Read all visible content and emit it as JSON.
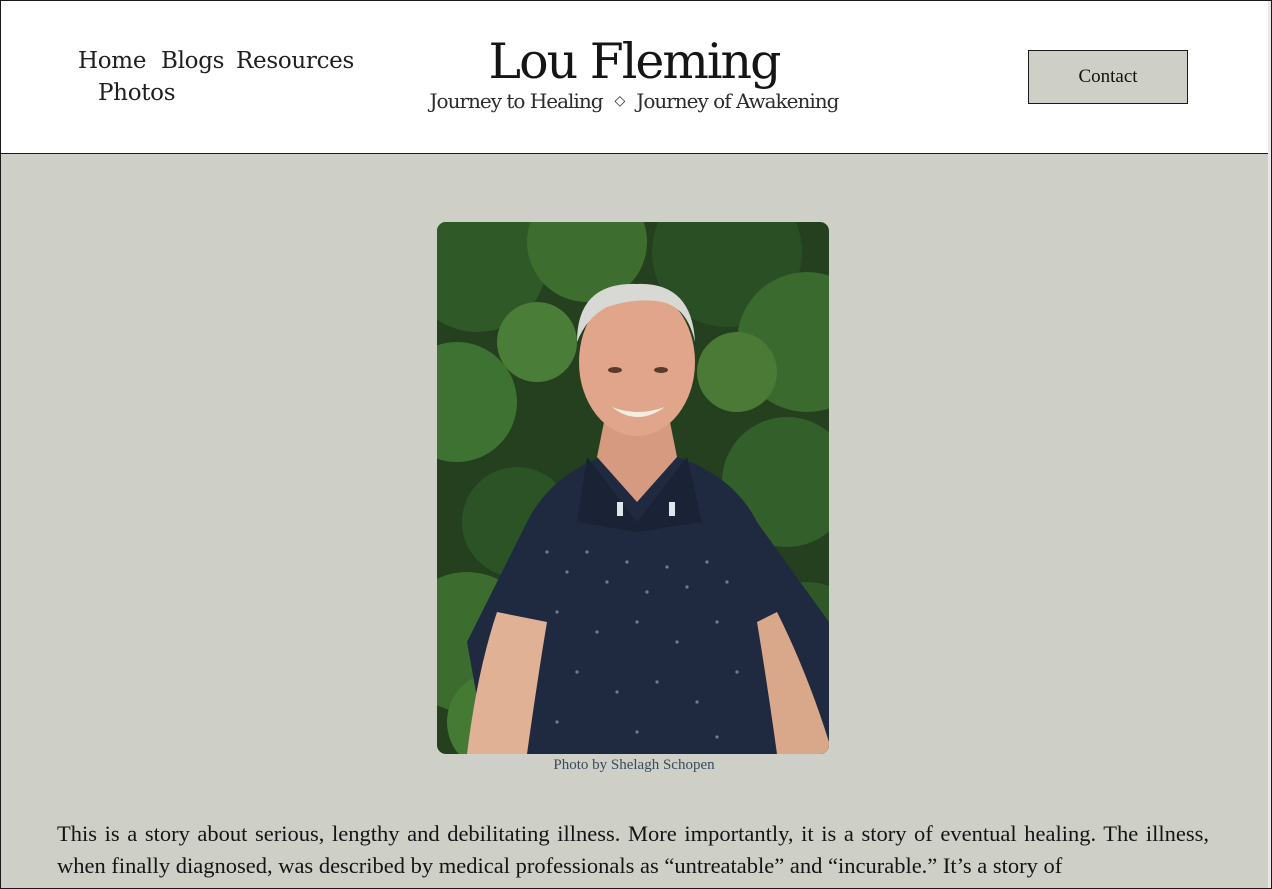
{
  "header": {
    "nav": [
      {
        "label": "Home"
      },
      {
        "label": "Blogs"
      },
      {
        "label": "Resources"
      },
      {
        "label": "Photos"
      }
    ],
    "site_title": "Lou Fleming",
    "tagline_left": "Journey to Healing",
    "tagline_separator": "◇",
    "tagline_right": "Journey of Awakening",
    "contact_label": "Contact"
  },
  "main": {
    "photo_caption": "Photo by Shelagh Schopen",
    "story_text": "This is a story about serious, lengthy and debilitating illness. More importantly, it is a story of eventual healing. The illness, when finally diagnosed, was described by medical professionals as “untreatable” and “incurable.” It’s a story of"
  },
  "colors": {
    "page_background": "#cecfc6",
    "header_background": "#ffffff",
    "button_background": "#cecfc6",
    "text": "#1a1a1a",
    "caption": "#3b4a5a"
  }
}
